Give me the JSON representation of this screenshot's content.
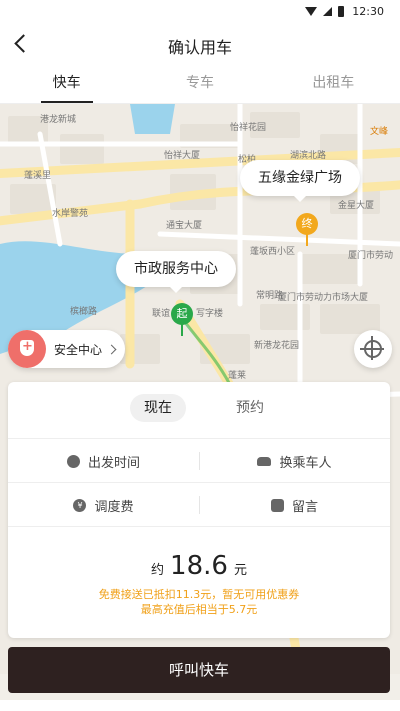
{
  "status_bar": {
    "time": "12:30"
  },
  "header": {
    "title": "确认用车"
  },
  "tabs": [
    {
      "label": "快车"
    },
    {
      "label": "专车"
    },
    {
      "label": "出租车"
    }
  ],
  "map": {
    "labels": [
      "港龙新城",
      "怡祥花园",
      "文峰",
      "蓬溪里",
      "怡祥大厦",
      "松柏",
      "湖滨北路",
      "水岸警苑",
      "通宝大厦",
      "金星大厦",
      "蓬坂西小区",
      "厦门市劳动",
      "常明路",
      "厦门市劳动力市场大厦",
      "槟榔路",
      "联谊",
      "写字楼",
      "新港龙花园",
      "蓬莱"
    ],
    "start_bubble": "市政服务中心",
    "end_bubble": "五缘金绿广场",
    "start_pin": "起",
    "end_pin": "终",
    "safety_label": "安全中心"
  },
  "card": {
    "mode_now": "现在",
    "mode_later": "预约",
    "departure_time": "出发时间",
    "change_passenger": "换乘车人",
    "dispatch_fee": "调度费",
    "message": "留言",
    "price_prefix": "约",
    "price_value": "18.6",
    "price_unit": "元",
    "promo_line1": "免费接送已抵扣11.3元，暂无可用优惠券",
    "promo_line2": "最高充值后相当于5.7元"
  },
  "call_button": "呼叫快车",
  "colors": {
    "start_pin": "#2aa84a",
    "end_pin": "#f2a81d",
    "water": "#9bd3ec",
    "road": "#fbe7a6",
    "promo": "#f0a018",
    "call_button": "#2e2120",
    "safety": "#ef6f6a"
  }
}
